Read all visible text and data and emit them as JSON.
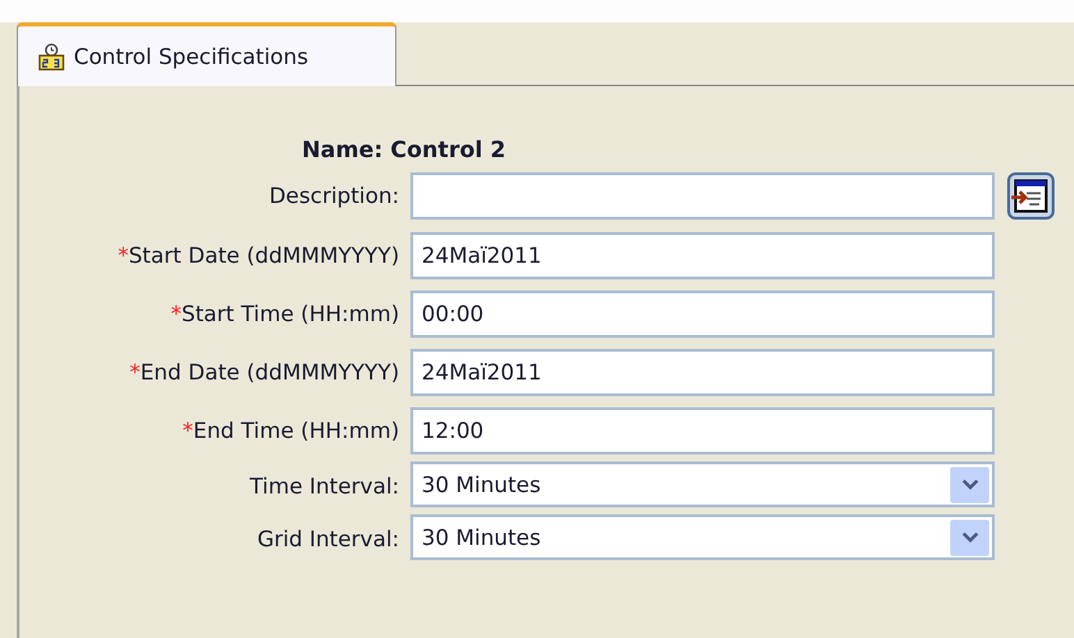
{
  "tabs": [
    {
      "label": "Control Specifications",
      "selected": true
    }
  ],
  "name_label": "Name: Control 2",
  "fields": [
    {
      "kind": "text",
      "label": "Description:",
      "required": false,
      "has_editor_button": true
    },
    {
      "kind": "text",
      "label": "Start Date (ddMMMYYYY)",
      "required": true,
      "value": "24Maï2011",
      "has_editor_button": false
    },
    {
      "kind": "text",
      "label": "Start Time (HH:mm)",
      "required": true,
      "value": "00:00",
      "has_editor_button": false
    },
    {
      "kind": "text",
      "label": "End Date (ddMMMYYYY)",
      "required": true,
      "value": "24Maï2011",
      "has_editor_button": false
    },
    {
      "kind": "text",
      "label": "End Time (HH:mm)",
      "required": true,
      "value": "12:00",
      "has_editor_button": false
    },
    {
      "kind": "dropdown",
      "label": "Time Interval:",
      "required": false,
      "value": "30 Minutes",
      "has_editor_button": false
    },
    {
      "kind": "dropdown",
      "label": "Grid Interval:",
      "required": false,
      "value": "30 Minutes",
      "has_editor_button": false
    }
  ],
  "required_marker": "*"
}
